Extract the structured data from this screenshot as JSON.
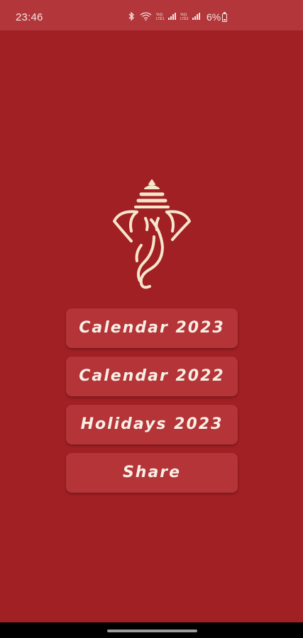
{
  "status_bar": {
    "time": "23:46",
    "lte1": "Vo)) LTE1",
    "lte2": "Vo)) LTE2",
    "battery": "6%",
    "icons": [
      "bluetooth-icon",
      "wifi-icon",
      "signal-icon",
      "battery-icon"
    ]
  },
  "logo": {
    "icon": "ganesha-logo",
    "color": "#f6e6cc"
  },
  "menu": {
    "items": [
      {
        "label": "Calendar 2023"
      },
      {
        "label": "Calendar 2022"
      },
      {
        "label": "Holidays 2023"
      },
      {
        "label": "Share"
      }
    ]
  },
  "colors": {
    "background": "#a02024",
    "status_bar": "#b3373a",
    "button": "#b43437",
    "button_text": "#f7efe6"
  }
}
